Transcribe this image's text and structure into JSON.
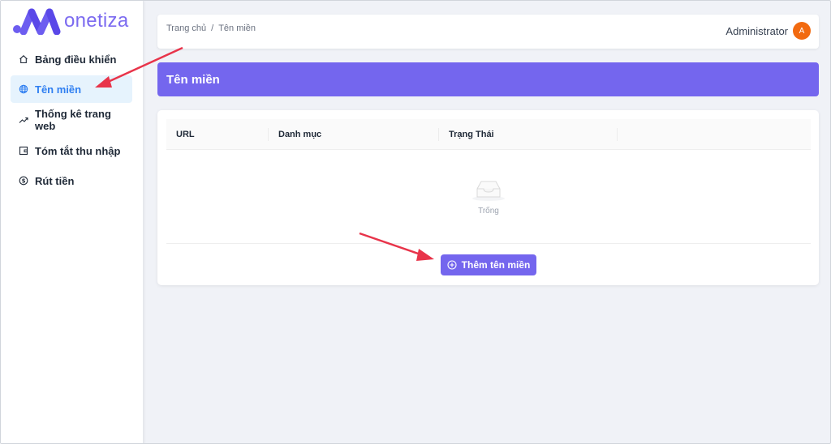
{
  "brand": {
    "name": "onetiza",
    "color": "#7466ee"
  },
  "sidebar": {
    "items": [
      {
        "label": "Bảng điều khiển",
        "icon": "home-icon",
        "active": false
      },
      {
        "label": "Tên miền",
        "icon": "globe-icon",
        "active": true
      },
      {
        "label": "Thống kê trang web",
        "icon": "trend-icon",
        "active": false
      },
      {
        "label": "Tóm tắt thu nhập",
        "icon": "wallet-icon",
        "active": false
      },
      {
        "label": "Rút tiền",
        "icon": "dollar-icon",
        "active": false
      }
    ]
  },
  "header": {
    "breadcrumb": [
      "Trang chủ",
      "/",
      "Tên miền"
    ],
    "user_name": "Administrator",
    "avatar_initial": "A"
  },
  "page": {
    "title": "Tên miền"
  },
  "table": {
    "columns": [
      "URL",
      "Danh mục",
      "Trạng Thái",
      ""
    ],
    "rows": [],
    "empty_text": "Trống"
  },
  "actions": {
    "add_label": "Thêm tên miền"
  },
  "colors": {
    "accent": "#7466ee",
    "active_nav_bg": "#e6f3fd",
    "active_nav_text": "#2f7ff1",
    "avatar": "#f26a10",
    "annotation": "#e8344a"
  }
}
